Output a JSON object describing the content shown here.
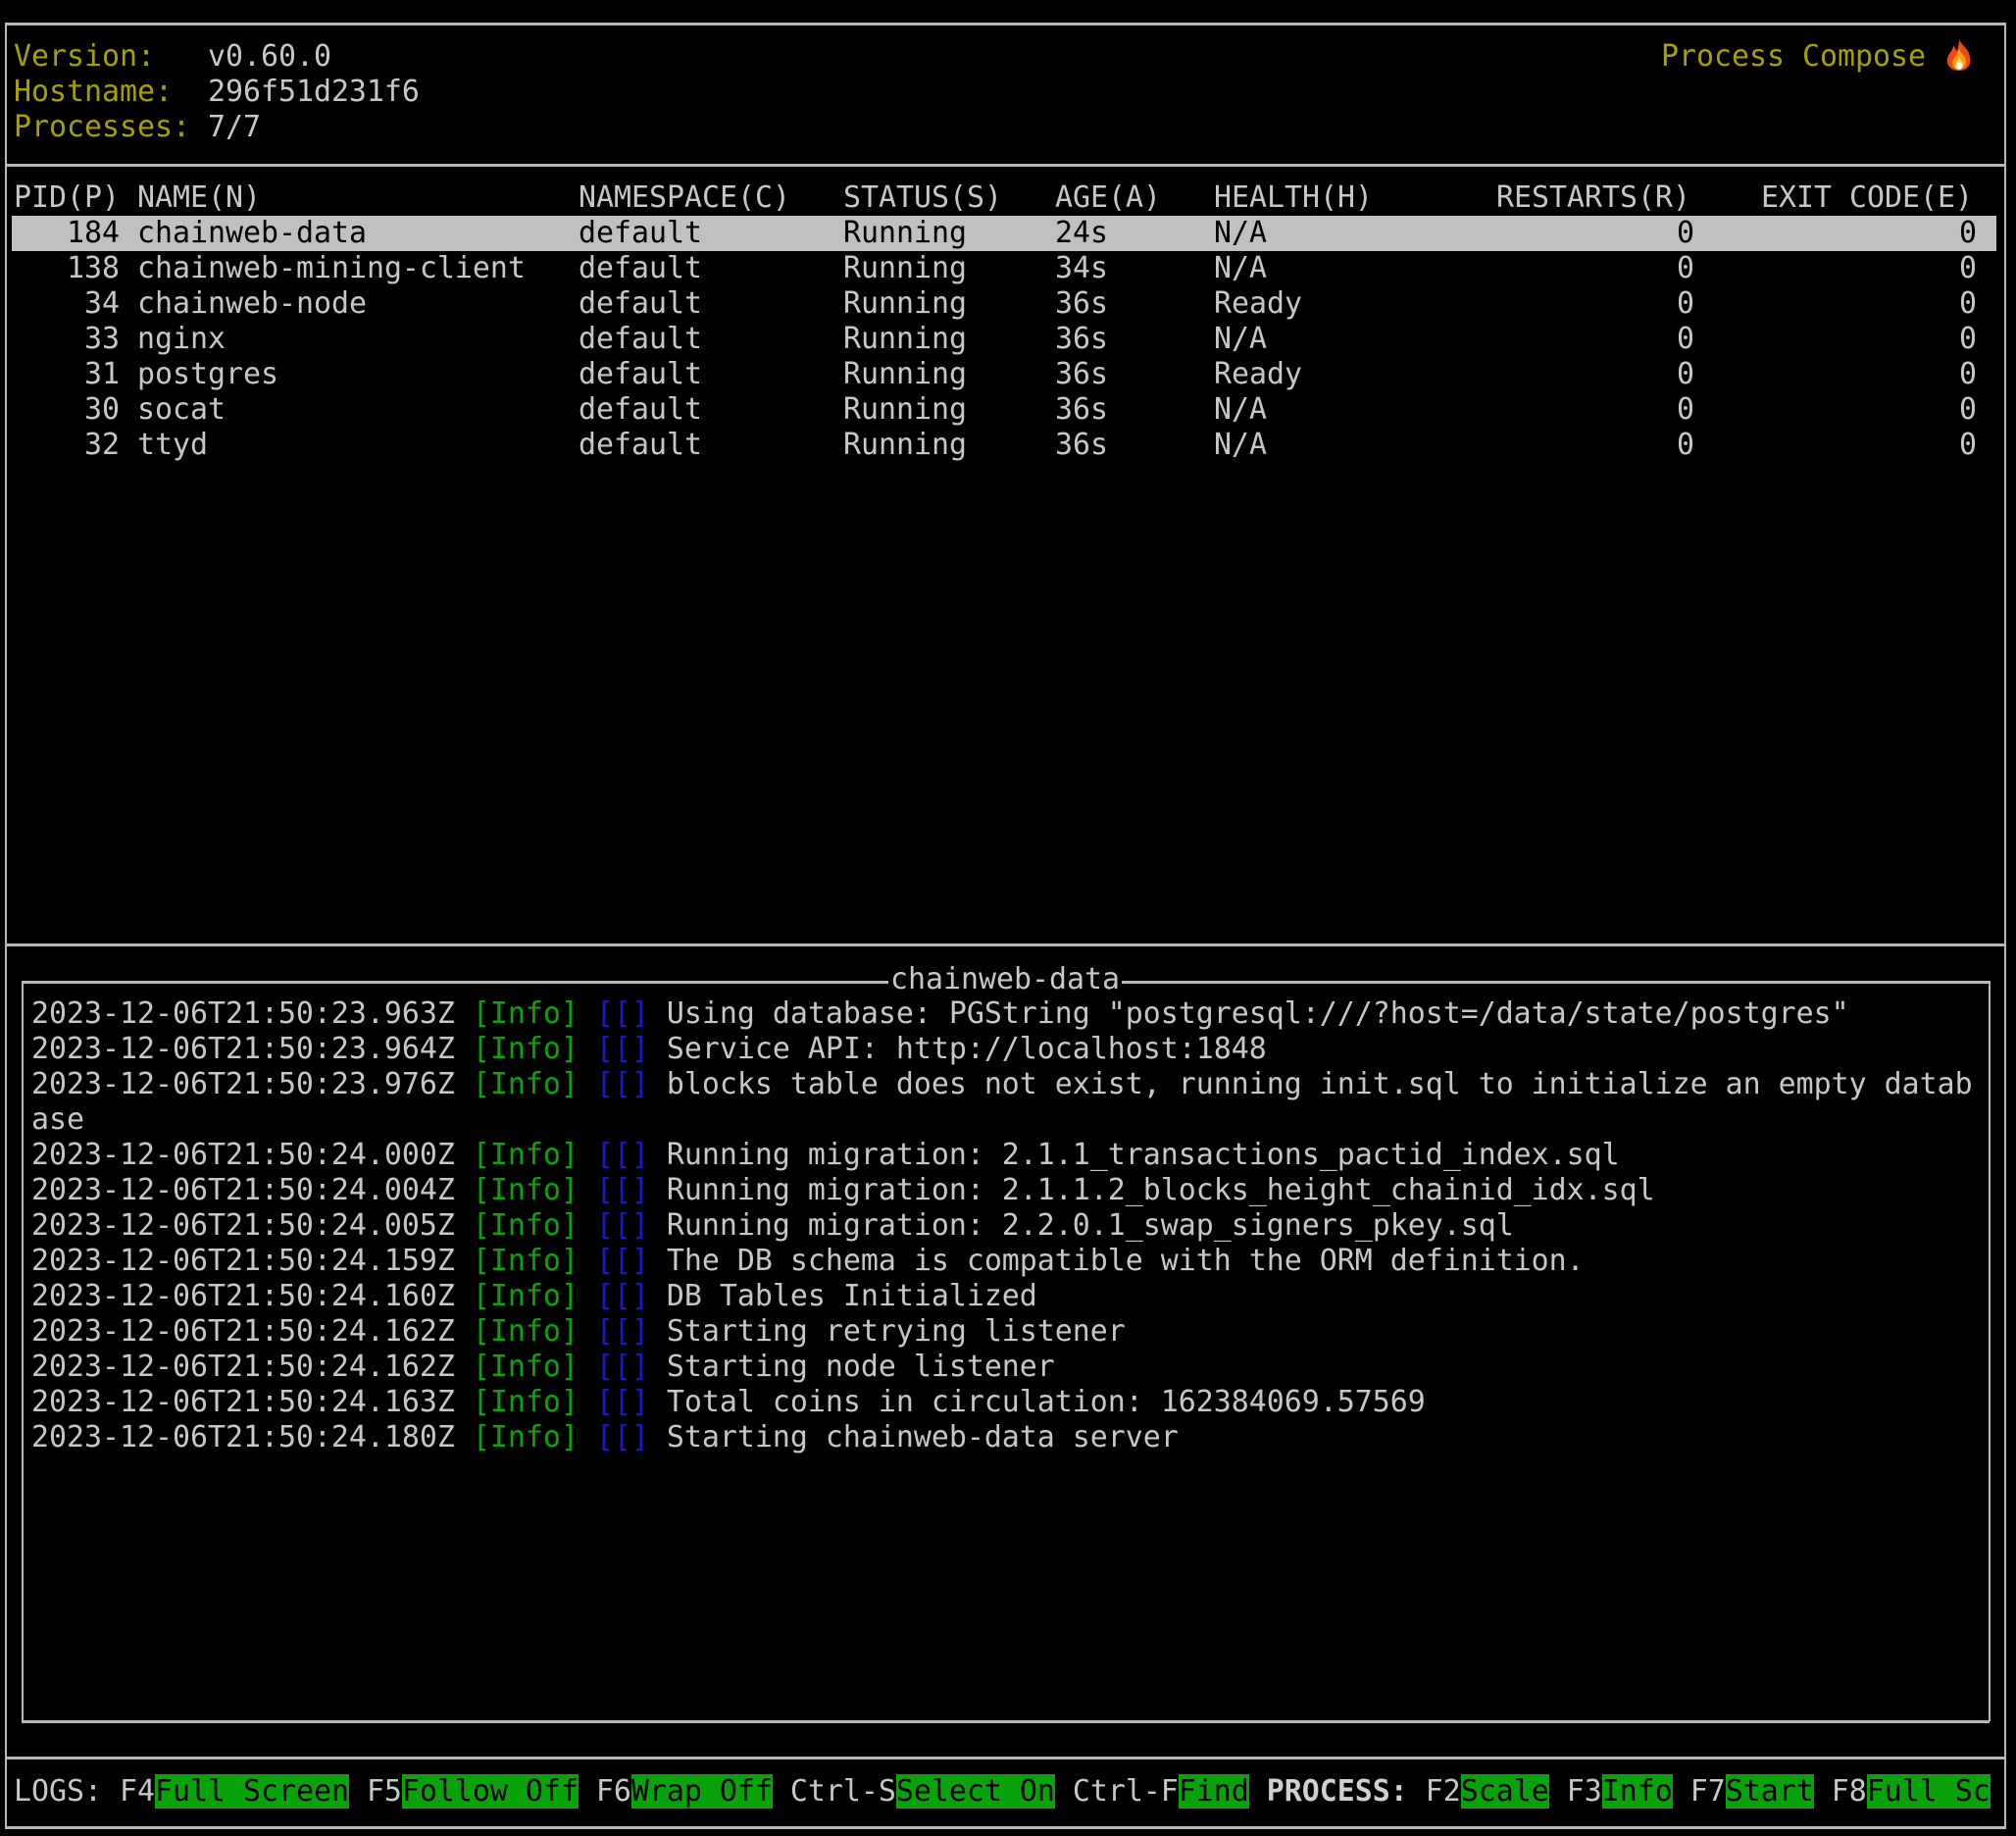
{
  "header": {
    "version_label": "Version:",
    "version_value": "v0.60.0",
    "hostname_label": "Hostname:",
    "hostname_value": "296f51d231f6",
    "processes_label": "Processes:",
    "processes_value": "7/7",
    "app_title": "Process Compose",
    "app_icon": "fire-icon"
  },
  "table": {
    "columns": [
      "PID(P)",
      "NAME(N)",
      "NAMESPACE(C)",
      "STATUS(S)",
      "AGE(A)",
      "HEALTH(H)",
      "RESTARTS(R)",
      "EXIT CODE(E)"
    ],
    "selected_index": 0,
    "rows": [
      {
        "pid": "184",
        "name": "chainweb-data",
        "namespace": "default",
        "status": "Running",
        "age": "24s",
        "health": "N/A",
        "restarts": "0",
        "exit_code": "0"
      },
      {
        "pid": "138",
        "name": "chainweb-mining-client",
        "namespace": "default",
        "status": "Running",
        "age": "34s",
        "health": "N/A",
        "restarts": "0",
        "exit_code": "0"
      },
      {
        "pid": "34",
        "name": "chainweb-node",
        "namespace": "default",
        "status": "Running",
        "age": "36s",
        "health": "Ready",
        "restarts": "0",
        "exit_code": "0"
      },
      {
        "pid": "33",
        "name": "nginx",
        "namespace": "default",
        "status": "Running",
        "age": "36s",
        "health": "N/A",
        "restarts": "0",
        "exit_code": "0"
      },
      {
        "pid": "31",
        "name": "postgres",
        "namespace": "default",
        "status": "Running",
        "age": "36s",
        "health": "Ready",
        "restarts": "0",
        "exit_code": "0"
      },
      {
        "pid": "30",
        "name": "socat",
        "namespace": "default",
        "status": "Running",
        "age": "36s",
        "health": "N/A",
        "restarts": "0",
        "exit_code": "0"
      },
      {
        "pid": "32",
        "name": "ttyd",
        "namespace": "default",
        "status": "Running",
        "age": "36s",
        "health": "N/A",
        "restarts": "0",
        "exit_code": "0"
      }
    ]
  },
  "logs": {
    "title": "chainweb-data",
    "lines": [
      {
        "ts": "2023-12-06T21:50:23.963Z",
        "level": "[Info]",
        "ctx": "[[]",
        "msg": "Using database: PGString \"postgresql:///?host=/data/state/postgres\""
      },
      {
        "ts": "2023-12-06T21:50:23.964Z",
        "level": "[Info]",
        "ctx": "[[]",
        "msg": "Service API: http://localhost:1848"
      },
      {
        "ts": "2023-12-06T21:50:23.976Z",
        "level": "[Info]",
        "ctx": "[[]",
        "msg": "blocks table does not exist, running init.sql to initialize an empty datab"
      },
      {
        "ts": "",
        "level": "",
        "ctx": "",
        "msg": "ase",
        "continuation": true
      },
      {
        "ts": "2023-12-06T21:50:24.000Z",
        "level": "[Info]",
        "ctx": "[[]",
        "msg": "Running migration: 2.1.1_transactions_pactid_index.sql"
      },
      {
        "ts": "2023-12-06T21:50:24.004Z",
        "level": "[Info]",
        "ctx": "[[]",
        "msg": "Running migration: 2.1.1.2_blocks_height_chainid_idx.sql"
      },
      {
        "ts": "2023-12-06T21:50:24.005Z",
        "level": "[Info]",
        "ctx": "[[]",
        "msg": "Running migration: 2.2.0.1_swap_signers_pkey.sql"
      },
      {
        "ts": "2023-12-06T21:50:24.159Z",
        "level": "[Info]",
        "ctx": "[[]",
        "msg": "The DB schema is compatible with the ORM definition."
      },
      {
        "ts": "2023-12-06T21:50:24.160Z",
        "level": "[Info]",
        "ctx": "[[]",
        "msg": "DB Tables Initialized"
      },
      {
        "ts": "2023-12-06T21:50:24.162Z",
        "level": "[Info]",
        "ctx": "[[]",
        "msg": "Starting retrying listener"
      },
      {
        "ts": "2023-12-06T21:50:24.162Z",
        "level": "[Info]",
        "ctx": "[[]",
        "msg": "Starting node listener"
      },
      {
        "ts": "2023-12-06T21:50:24.163Z",
        "level": "[Info]",
        "ctx": "[[]",
        "msg": "Total coins in circulation: 162384069.57569"
      },
      {
        "ts": "2023-12-06T21:50:24.180Z",
        "level": "[Info]",
        "ctx": "[[]",
        "msg": "Starting chainweb-data server"
      }
    ]
  },
  "footer": {
    "logs_label": "LOGS:",
    "process_label": "PROCESS:",
    "logs_shortcuts": [
      {
        "key": "F4",
        "action": "Full Screen"
      },
      {
        "key": "F5",
        "action": "Follow Off"
      },
      {
        "key": "F6",
        "action": "Wrap Off"
      },
      {
        "key": "Ctrl-S",
        "action": "Select On"
      },
      {
        "key": "Ctrl-F",
        "action": "Find"
      }
    ],
    "process_shortcuts": [
      {
        "key": "F2",
        "action": "Scale"
      },
      {
        "key": "F3",
        "action": "Info"
      },
      {
        "key": "F7",
        "action": "Start"
      },
      {
        "key": "F8",
        "action": "Full Sc"
      }
    ]
  },
  "colors": {
    "label_yellow": "#a6a000",
    "text": "#c7c7c7",
    "selection_bg": "#c0c0c0",
    "info_green": "#0ca20c",
    "bracket_blue": "#1818c8",
    "shortcut_bg": "#0aa20a"
  }
}
